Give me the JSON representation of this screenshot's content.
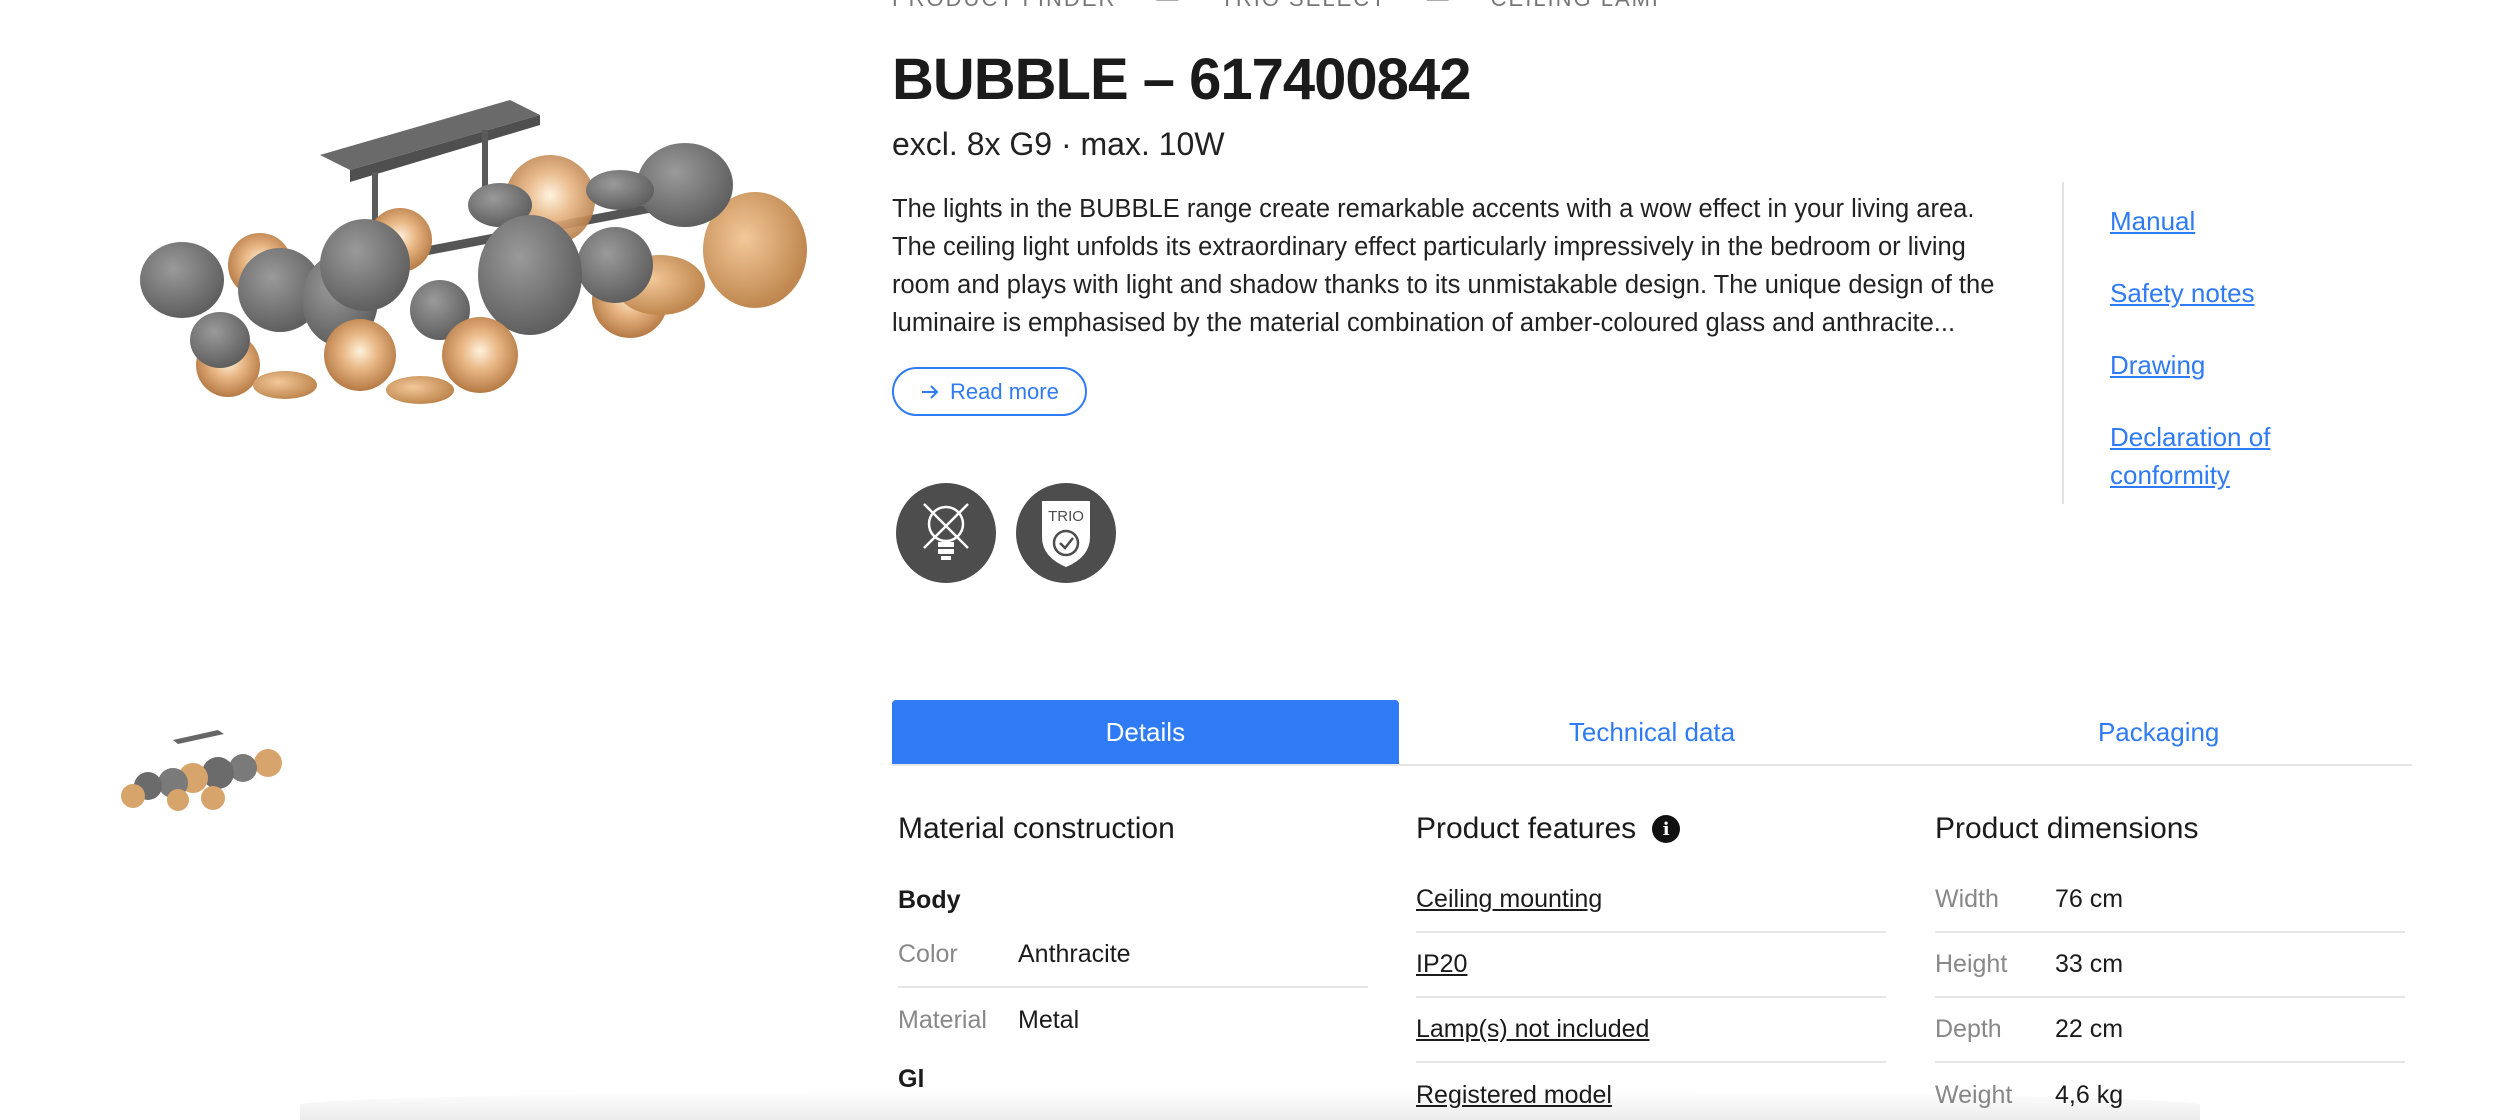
{
  "breadcrumb": [
    "PRODUCT FINDER",
    "TRIO SELECT",
    "CEILING LAMP"
  ],
  "product": {
    "title": "BUBBLE – 617400842",
    "subtitle": "excl. 8x G9 · max. 10W",
    "description": "The lights in the BUBBLE range create remarkable accents with a wow effect in your living area. The ceiling light unfolds its extraordinary effect particularly impressively in the bedroom or living room and plays with light and shadow thanks to its unmistakable design. The unique design of the luminaire is emphasised by the material combination of amber-coloured glass and anthracite...",
    "read_more": "Read more"
  },
  "links": [
    "Manual",
    "Safety notes",
    "Drawing",
    "Declaration of conformity"
  ],
  "badges": [
    {
      "icon": "no-bulb-icon"
    },
    {
      "icon": "trio-quality-icon",
      "text": "TRIO"
    }
  ],
  "tabs": [
    "Details",
    "Technical data",
    "Packaging"
  ],
  "active_tab": "Details",
  "material": {
    "heading": "Material construction",
    "sections": [
      {
        "title": "Body",
        "rows": [
          {
            "label": "Color",
            "value": "Anthracite"
          },
          {
            "label": "Material",
            "value": "Metal"
          }
        ]
      }
    ],
    "next_section_partial": "Gl"
  },
  "features": {
    "heading": "Product features",
    "items": [
      "Ceiling mounting",
      "IP20",
      "Lamp(s) not included",
      "Registered model"
    ]
  },
  "dimensions": {
    "heading": "Product dimensions",
    "rows": [
      {
        "label": "Width",
        "value": "76 cm"
      },
      {
        "label": "Height",
        "value": "33 cm"
      },
      {
        "label": "Depth",
        "value": "22 cm"
      },
      {
        "label": "Weight",
        "value": "4,6 kg"
      }
    ]
  },
  "colors": {
    "accent": "#2f7bf5",
    "badge_bg": "#4d4d4d"
  }
}
